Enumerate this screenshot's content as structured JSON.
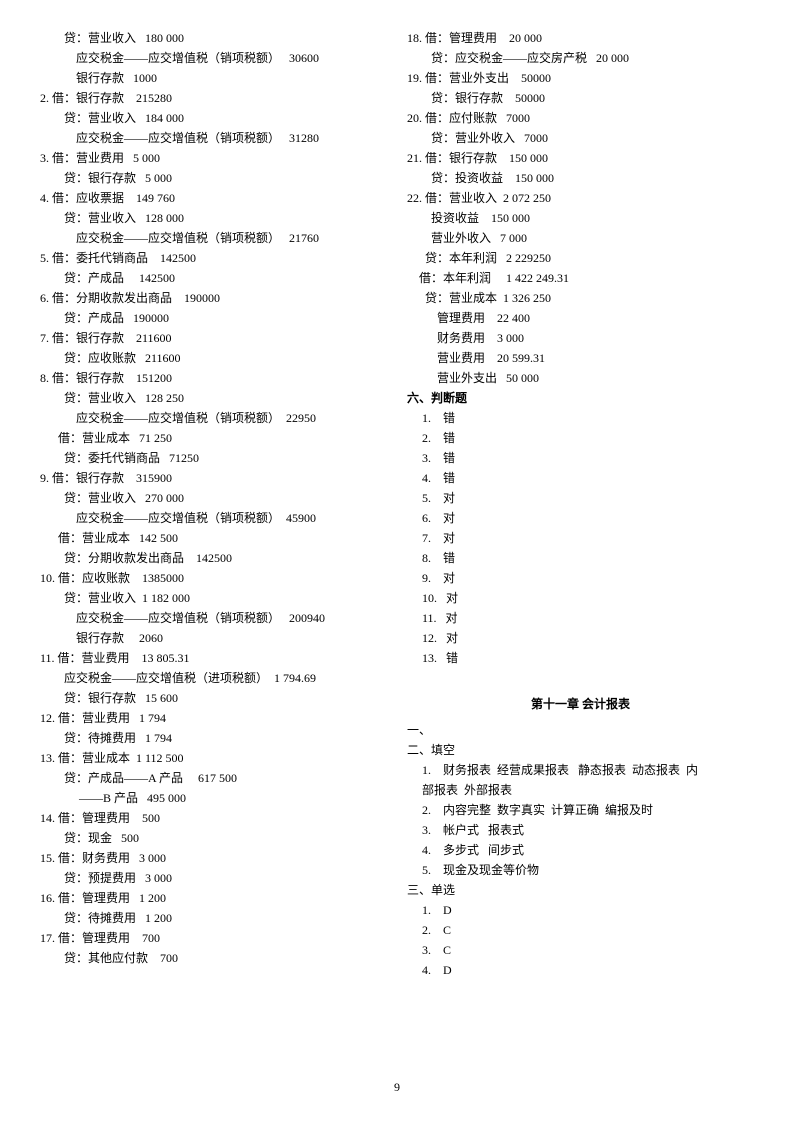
{
  "left": [
    "        贷：营业收入   180 000",
    "            应交税金——应交增值税（销项税额）   30600",
    "            银行存款   1000",
    "2. 借：银行存款    215280",
    "        贷：营业收入   184 000",
    "            应交税金——应交增值税（销项税额）   31280",
    "3. 借：营业费用   5 000",
    "        贷：银行存款   5 000",
    "4. 借：应收票据    149 760",
    "        贷：营业收入   128 000",
    "            应交税金——应交增值税（销项税额）   21760",
    "5. 借：委托代销商品    142500",
    "        贷：产成品     142500",
    "6. 借：分期收款发出商品    190000",
    "        贷：产成品   190000",
    "7. 借：银行存款    211600",
    "        贷：应收账款   211600",
    "8. 借：银行存款    151200",
    "        贷：营业收入   128 250",
    "            应交税金——应交增值税（销项税额）  22950",
    "      借：营业成本   71 250",
    "        贷：委托代销商品   71250",
    "9. 借：银行存款    315900",
    "        贷：营业收入   270 000",
    "            应交税金——应交增值税（销项税额）  45900",
    "      借：营业成本   142 500",
    "        贷：分期收款发出商品    142500",
    "10. 借：应收账款    1385000",
    "        贷：营业收入  1 182 000",
    "            应交税金——应交增值税（销项税额）   200940",
    "            银行存款     2060",
    "11. 借：营业费用    13 805.31",
    "        应交税金——应交增值税（进项税额）  1 794.69",
    "        贷：银行存款   15 600",
    "12. 借：营业费用   1 794",
    "        贷：待摊费用   1 794",
    "13. 借：营业成本  1 112 500",
    "        贷：产成品——A 产品     617 500",
    "             ——B 产品   495 000",
    "14. 借：管理费用    500",
    "        贷：现金   500",
    "15. 借：财务费用   3 000",
    "        贷：预提费用   3 000",
    "16. 借：管理费用   1 200",
    "        贷：待摊费用   1 200",
    "17. 借：管理费用    700",
    "        贷：其他应付款    700"
  ],
  "rightTop": [
    "18. 借：管理费用    20 000",
    "        贷：应交税金——应交房产税   20 000",
    "19. 借：营业外支出    50000",
    "        贷：银行存款    50000",
    "20. 借：应付账款   7000",
    "        贷：营业外收入   7000",
    "21. 借：银行存款    150 000",
    "        贷：投资收益    150 000",
    "22. 借：营业收入  2 072 250",
    "        投资收益    150 000",
    "        营业外收入   7 000",
    "      贷：本年利润   2 229250",
    "    借：本年利润     1 422 249.31",
    "      贷：营业成本  1 326 250",
    "          管理费用    22 400",
    "          财务费用    3 000",
    "          营业费用    20 599.31",
    "          营业外支出   50 000"
  ],
  "judgeTitle": "六、判断题",
  "judge": [
    "1.    错",
    "2.    错",
    "3.    错",
    "4.    错",
    "5.    对",
    "6.    对",
    "7.    对",
    "8.    错",
    "9.    对",
    "10.   对",
    "11.   对",
    "12.   对",
    "13.   错"
  ],
  "chapterTitle": "第十一章 会计报表",
  "sec1": "一、",
  "sec2": "二、填空",
  "fill": [
    "1.    财务报表  经营成果报表   静态报表  动态报表  内",
    "部报表  外部报表",
    "2.    内容完整  数字真实  计算正确  编报及时",
    "3.    帐户式   报表式",
    "4.    多步式   间步式",
    "5.    现金及现金等价物"
  ],
  "sec3": "三、单选",
  "single": [
    "1.    D",
    "2.    C",
    "3.    C",
    "4.    D"
  ],
  "pageNumber": "9"
}
